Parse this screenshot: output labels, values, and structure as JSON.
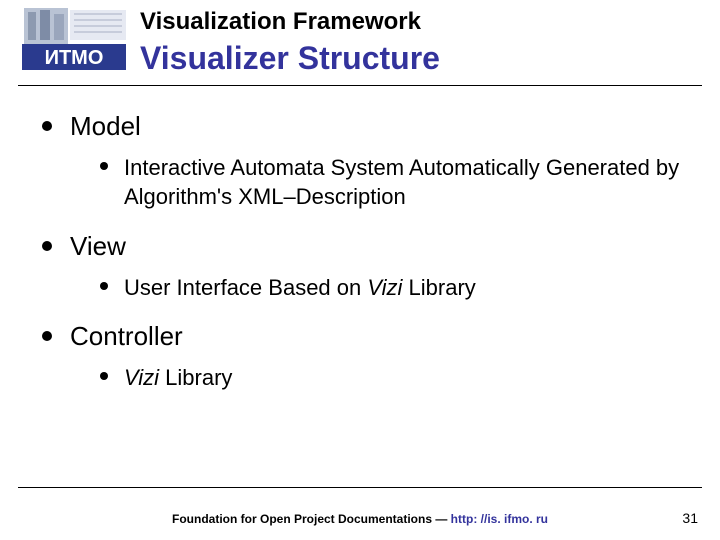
{
  "header": {
    "supertitle": "Visualization Framework",
    "title": "Visualizer Structure"
  },
  "bullets": [
    {
      "label": "Model",
      "sub": [
        {
          "text": "Interactive Automata System Automatically Generated by Algorithm's XML–Description"
        }
      ]
    },
    {
      "label": "View",
      "sub": [
        {
          "prefix": "User Interface Based on ",
          "em": "Vizi",
          "suffix": " Library"
        }
      ]
    },
    {
      "label": "Controller",
      "sub": [
        {
          "em": "Vizi",
          "suffix": " Library"
        }
      ]
    }
  ],
  "footer": {
    "text": "Foundation for Open Project Documentations — ",
    "url": "http: //is. ifmo. ru"
  },
  "page_number": "31",
  "logo_label": "ИTMO"
}
